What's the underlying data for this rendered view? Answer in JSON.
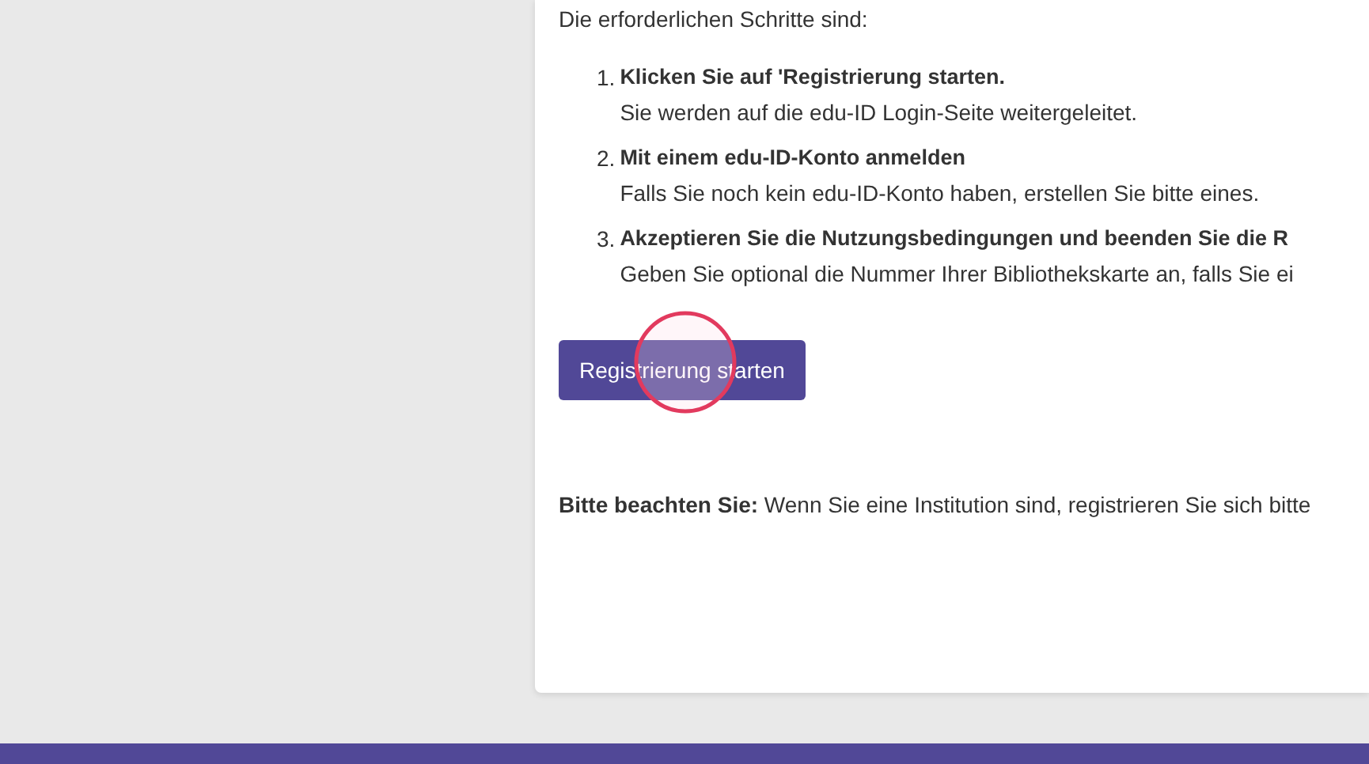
{
  "intro": "Die erforderlichen Schritte sind:",
  "steps": [
    {
      "number": "1.",
      "title": "Klicken Sie auf 'Registrierung starten.",
      "text": "Sie werden auf die edu-ID Login-Seite weitergeleitet."
    },
    {
      "number": "2.",
      "title": "Mit einem edu-ID-Konto anmelden",
      "text": "Falls Sie noch kein edu-ID-Konto haben, erstellen Sie bitte eines."
    },
    {
      "number": "3.",
      "title": "Akzeptieren Sie die Nutzungsbedingungen und beenden Sie die R",
      "text": "Geben Sie optional die Nummer Ihrer Bibliothekskarte an, falls Sie ei"
    }
  ],
  "button": "Registrierung starten",
  "note": "**Bitte beachten Sie:** Wenn Sie eine Institution sind, registrieren Sie sich bitte"
}
